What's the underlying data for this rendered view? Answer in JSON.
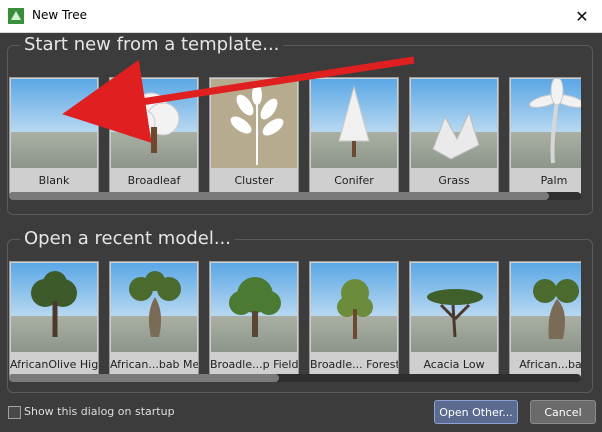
{
  "window": {
    "title": "New Tree",
    "close_label": "✕"
  },
  "templates": {
    "heading": "Start new from a template...",
    "items": [
      {
        "label": "Blank",
        "icon": "blank-template-icon"
      },
      {
        "label": "Broadleaf",
        "icon": "broadleaf-tree-icon"
      },
      {
        "label": "Cluster",
        "icon": "cluster-leaf-icon"
      },
      {
        "label": "Conifer",
        "icon": "conifer-tree-icon"
      },
      {
        "label": "Grass",
        "icon": "grass-icon"
      },
      {
        "label": "Palm",
        "icon": "palm-tree-icon"
      }
    ]
  },
  "recent": {
    "heading": "Open a recent model...",
    "items": [
      {
        "label": "AfricanOlive High",
        "icon": "african-olive-tree-icon"
      },
      {
        "label": "African...bab Med",
        "icon": "baobab-tree-icon"
      },
      {
        "label": "Broadle...p Field",
        "icon": "broadleaf-tree-icon"
      },
      {
        "label": "Broadle... Forest",
        "icon": "broadleaf-forest-tree-icon"
      },
      {
        "label": "Acacia Low",
        "icon": "acacia-tree-icon"
      },
      {
        "label": "African...bab",
        "icon": "baobab-tree-icon"
      }
    ]
  },
  "footer": {
    "show_on_startup_label": "Show this dialog on startup",
    "open_other_label": "Open Other...",
    "cancel_label": "Cancel"
  },
  "colors": {
    "background": "#3c3c3c",
    "accent_button": "#5a6b8f",
    "annotation_arrow": "#e02020"
  }
}
